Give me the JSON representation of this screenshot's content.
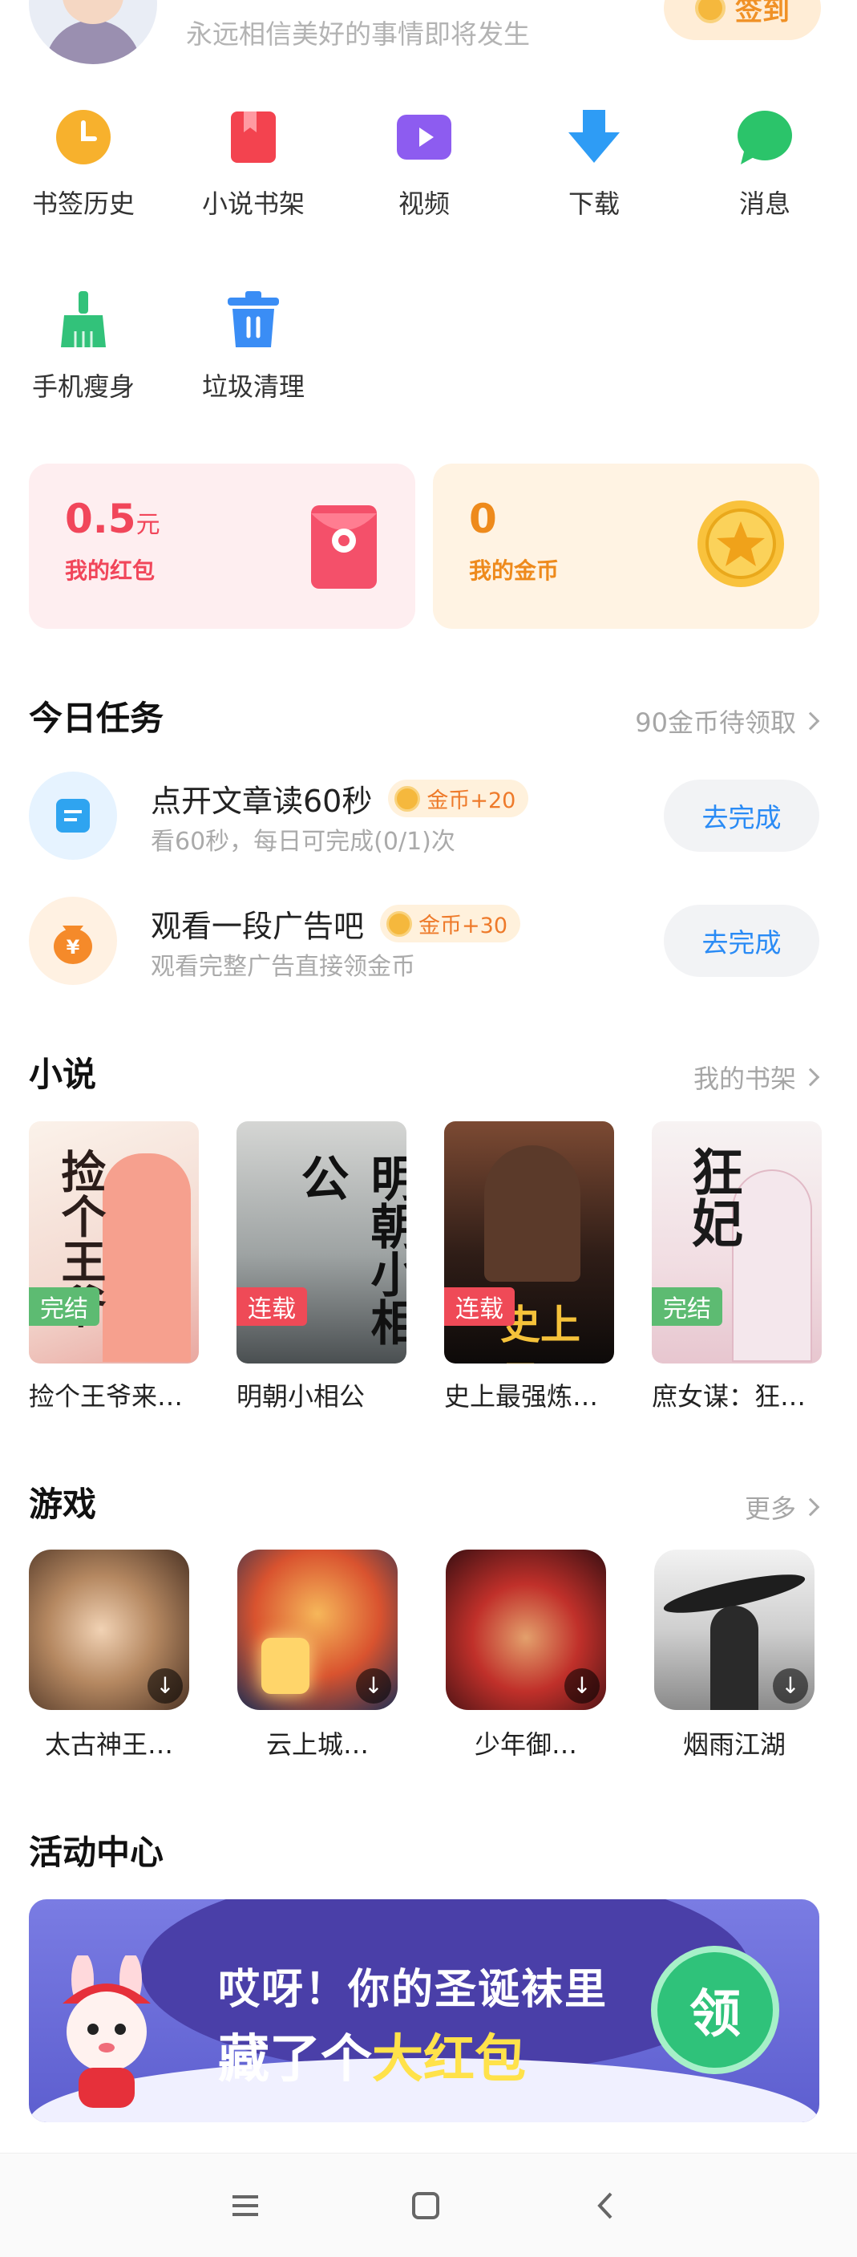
{
  "profile": {
    "motto": "永远相信美好的事情即将发生",
    "signin_label": "签到"
  },
  "shortcuts": [
    {
      "label": "书签历史",
      "icon": "clock-icon",
      "color": "#f7b12d"
    },
    {
      "label": "小说书架",
      "icon": "book-icon",
      "color": "#f3434f"
    },
    {
      "label": "视频",
      "icon": "video-icon",
      "color": "#8d5cf0"
    },
    {
      "label": "下载",
      "icon": "download-icon",
      "color": "#2e9cf5"
    },
    {
      "label": "消息",
      "icon": "message-icon",
      "color": "#2bc46a"
    },
    {
      "label": "手机瘦身",
      "icon": "broom-icon",
      "color": "#32c27a"
    },
    {
      "label": "垃圾清理",
      "icon": "trash-icon",
      "color": "#3a8df5"
    }
  ],
  "wallet": {
    "redpacket": {
      "value": "0.5",
      "unit": "元",
      "label": "我的红包"
    },
    "coins": {
      "value": "0",
      "label": "我的金币"
    }
  },
  "tasks": {
    "title": "今日任务",
    "more": "90金币待领取",
    "items": [
      {
        "title": "点开文章读60秒",
        "badge": "金币+20",
        "desc": "看60秒，每日可完成(0/1)次",
        "action": "去完成"
      },
      {
        "title": "观看一段广告吧",
        "badge": "金币+30",
        "desc": "观看完整广告直接领金币",
        "action": "去完成"
      }
    ]
  },
  "novels": {
    "title": "小说",
    "more": "我的书架",
    "items": [
      {
        "name": "捡个王爷来…",
        "tag": "完结",
        "cover_text": "捡个王爷"
      },
      {
        "name": "明朝小相公",
        "tag": "连载",
        "cover_text": "明朝小相公"
      },
      {
        "name": "史上最强炼…",
        "tag": "连载",
        "cover_text": "史上最强"
      },
      {
        "name": "庶女谋：狂…",
        "tag": "完结",
        "cover_text": "狂妃"
      }
    ]
  },
  "games": {
    "title": "游戏",
    "more": "更多",
    "items": [
      {
        "name": "太古神王…"
      },
      {
        "name": "云上城…"
      },
      {
        "name": "少年御…"
      },
      {
        "name": "烟雨江湖"
      }
    ]
  },
  "activity": {
    "title": "活动中心",
    "banner_line1": "哎呀！你的圣诞袜里",
    "banner_line2a": "藏了个",
    "banner_line2b": "大红包",
    "claim": "领"
  }
}
